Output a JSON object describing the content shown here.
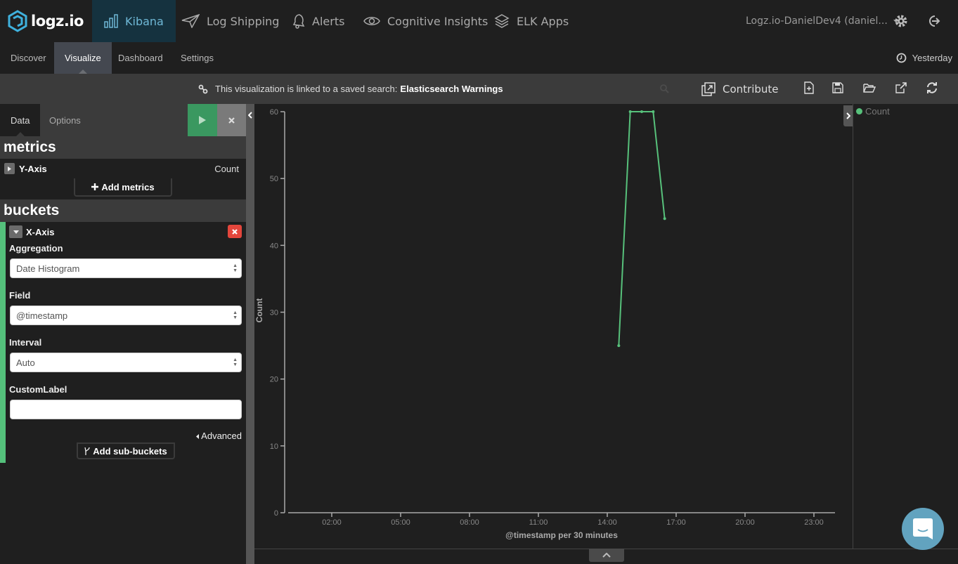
{
  "topnav": {
    "logo": "logz.io",
    "items": [
      {
        "label": "Kibana",
        "icon": "bar-chart-icon",
        "active": true
      },
      {
        "label": "Log Shipping",
        "icon": "paper-plane-icon",
        "active": false
      },
      {
        "label": "Alerts",
        "icon": "bell-icon",
        "active": false
      },
      {
        "label": "Cognitive Insights",
        "icon": "eye-icon",
        "active": false
      },
      {
        "label": "ELK Apps",
        "icon": "layers-icon",
        "active": false
      }
    ],
    "account": "Logz.io-DanielDev4 (daniel...",
    "settings_icon": "gear-icon",
    "logout_icon": "sign-out-icon"
  },
  "subnav": {
    "tabs": [
      {
        "label": "Discover",
        "active": false
      },
      {
        "label": "Visualize",
        "active": true
      },
      {
        "label": "Dashboard",
        "active": false
      },
      {
        "label": "Settings",
        "active": false
      }
    ],
    "time_range": "Yesterday"
  },
  "linkbar": {
    "message": "This visualization is linked to a saved search:",
    "saved_search": "Elasticsearch Warnings",
    "contribute_label": "Contribute",
    "toolbar_icons": [
      "new-visualization-icon",
      "save-icon",
      "open-icon",
      "share-icon",
      "refresh-icon"
    ]
  },
  "sidebar": {
    "tabs": [
      {
        "label": "Data",
        "active": true
      },
      {
        "label": "Options",
        "active": false
      }
    ],
    "metrics_heading": "metrics",
    "metric": {
      "title": "Y-Axis",
      "value": "Count"
    },
    "add_metrics_label": "Add metrics",
    "buckets_heading": "buckets",
    "bucket": {
      "title": "X-Axis",
      "aggregation_label": "Aggregation",
      "aggregation_value": "Date Histogram",
      "field_label": "Field",
      "field_value": "@timestamp",
      "interval_label": "Interval",
      "interval_value": "Auto",
      "custom_label_label": "CustomLabel",
      "custom_label_value": "",
      "advanced_label": "Advanced"
    },
    "add_sub_buckets_label": "Add sub-buckets"
  },
  "colors": {
    "accent": "#6fb8d6",
    "run": "#3a9860",
    "series": "#57c17b",
    "remove": "#e4463c"
  },
  "chart_data": {
    "type": "line",
    "title": "",
    "xlabel": "@timestamp per 30 minutes",
    "ylabel": "Count",
    "x_ticks": [
      "02:00",
      "05:00",
      "08:00",
      "11:00",
      "14:00",
      "17:00",
      "20:00",
      "23:00"
    ],
    "y_ticks": [
      0,
      10,
      20,
      30,
      40,
      50,
      60
    ],
    "ylim": [
      0,
      60
    ],
    "xlim_hours": [
      0.25,
      24
    ],
    "legend": "right",
    "series": [
      {
        "name": "Count",
        "x": [
          "14:30",
          "15:00",
          "15:30",
          "16:00",
          "16:30"
        ],
        "x_hours": [
          14.5,
          15.0,
          15.5,
          16.0,
          16.5
        ],
        "values": [
          25,
          60,
          60,
          60,
          44
        ]
      }
    ]
  }
}
